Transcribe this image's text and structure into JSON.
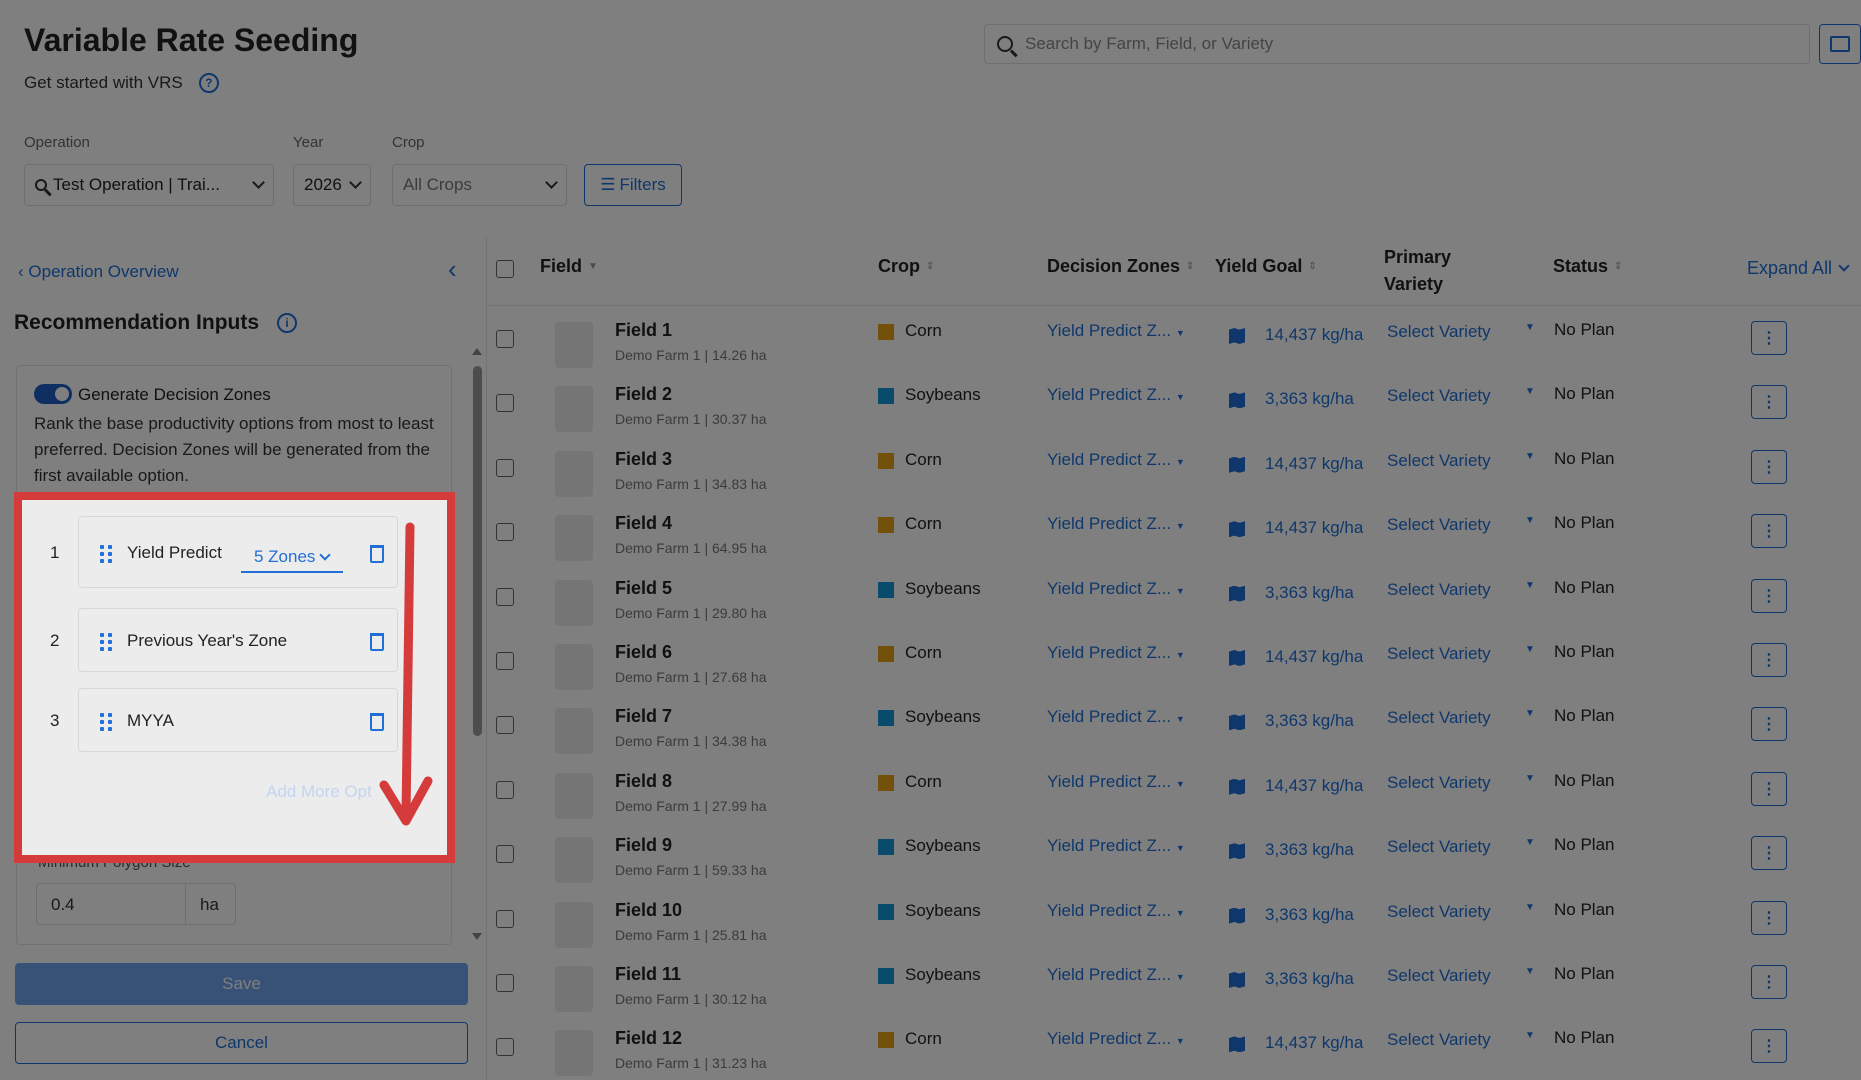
{
  "header": {
    "title": "Variable Rate Seeding",
    "subtitle": "Get started with VRS",
    "search_placeholder": "Search by Farm, Field, or Variety"
  },
  "filters": {
    "operation_label": "Operation",
    "operation_value": "Test Operation | Trai...",
    "year_label": "Year",
    "year_value": "2026",
    "crop_label": "Crop",
    "crop_value": "All Crops",
    "filters_button": "Filters"
  },
  "left_panel": {
    "back_link": "Operation Overview",
    "title": "Recommendation Inputs",
    "toggle_label": "Generate Decision Zones",
    "description": "Rank the base productivity options from most to least preferred. Decision Zones will be generated from the first available option.",
    "zone_options": [
      {
        "rank": "1",
        "label": "Yield Predict",
        "zones": "5 Zones"
      },
      {
        "rank": "2",
        "label": "Previous Year's Zone"
      },
      {
        "rank": "3",
        "label": "MYYA"
      }
    ],
    "add_more": "Add More Opt",
    "min_polygon_label": "Minimum Polygon Size",
    "min_polygon_value": "0.4",
    "min_polygon_unit": "ha",
    "save": "Save",
    "cancel": "Cancel"
  },
  "table": {
    "headers": {
      "field": "Field",
      "crop": "Crop",
      "decision_zones": "Decision Zones",
      "yield_goal": "Yield Goal",
      "primary_variety": "Primary Variety",
      "status": "Status",
      "expand_all": "Expand All"
    },
    "rows": [
      {
        "field": "Field 1",
        "sub": "Demo Farm 1   |  14.26 ha",
        "crop": "Corn",
        "zone": "Yield Predict Z...",
        "goal": "14,437 kg/ha",
        "variety": "Select Variety",
        "status": "No Plan"
      },
      {
        "field": "Field 2",
        "sub": "Demo Farm 1   |  30.37 ha",
        "crop": "Soybeans",
        "zone": "Yield Predict Z...",
        "goal": "3,363 kg/ha",
        "variety": "Select Variety",
        "status": "No Plan"
      },
      {
        "field": "Field 3",
        "sub": "Demo Farm 1   |  34.83 ha",
        "crop": "Corn",
        "zone": "Yield Predict Z...",
        "goal": "14,437 kg/ha",
        "variety": "Select Variety",
        "status": "No Plan"
      },
      {
        "field": "Field 4",
        "sub": "Demo Farm 1   |  64.95 ha",
        "crop": "Corn",
        "zone": "Yield Predict Z...",
        "goal": "14,437 kg/ha",
        "variety": "Select Variety",
        "status": "No Plan"
      },
      {
        "field": "Field 5",
        "sub": "Demo Farm 1   |  29.80 ha",
        "crop": "Soybeans",
        "zone": "Yield Predict Z...",
        "goal": "3,363 kg/ha",
        "variety": "Select Variety",
        "status": "No Plan"
      },
      {
        "field": "Field 6",
        "sub": "Demo Farm 1   |  27.68 ha",
        "crop": "Corn",
        "zone": "Yield Predict Z...",
        "goal": "14,437 kg/ha",
        "variety": "Select Variety",
        "status": "No Plan"
      },
      {
        "field": "Field 7",
        "sub": "Demo Farm 1   |  34.38 ha",
        "crop": "Soybeans",
        "zone": "Yield Predict Z...",
        "goal": "3,363 kg/ha",
        "variety": "Select Variety",
        "status": "No Plan"
      },
      {
        "field": "Field 8",
        "sub": "Demo Farm 1   |  27.99 ha",
        "crop": "Corn",
        "zone": "Yield Predict Z...",
        "goal": "14,437 kg/ha",
        "variety": "Select Variety",
        "status": "No Plan"
      },
      {
        "field": "Field 9",
        "sub": "Demo Farm 1   |  59.33 ha",
        "crop": "Soybeans",
        "zone": "Yield Predict Z...",
        "goal": "3,363 kg/ha",
        "variety": "Select Variety",
        "status": "No Plan"
      },
      {
        "field": "Field 10",
        "sub": "Demo Farm 1   |  25.81 ha",
        "crop": "Soybeans",
        "zone": "Yield Predict Z...",
        "goal": "3,363 kg/ha",
        "variety": "Select Variety",
        "status": "No Plan"
      },
      {
        "field": "Field 11",
        "sub": "Demo Farm 1   |  30.12 ha",
        "crop": "Soybeans",
        "zone": "Yield Predict Z...",
        "goal": "3,363 kg/ha",
        "variety": "Select Variety",
        "status": "No Plan"
      },
      {
        "field": "Field 12",
        "sub": "Demo Farm 1   |  31.23 ha",
        "crop": "Corn",
        "zone": "Yield Predict Z...",
        "goal": "14,437 kg/ha",
        "variety": "Select Variety",
        "status": "No Plan"
      }
    ]
  },
  "colors": {
    "accent": "#1f6fd6",
    "corn": "#e8a317",
    "soybeans": "#1196d6",
    "highlight_border": "#d63b3b"
  }
}
